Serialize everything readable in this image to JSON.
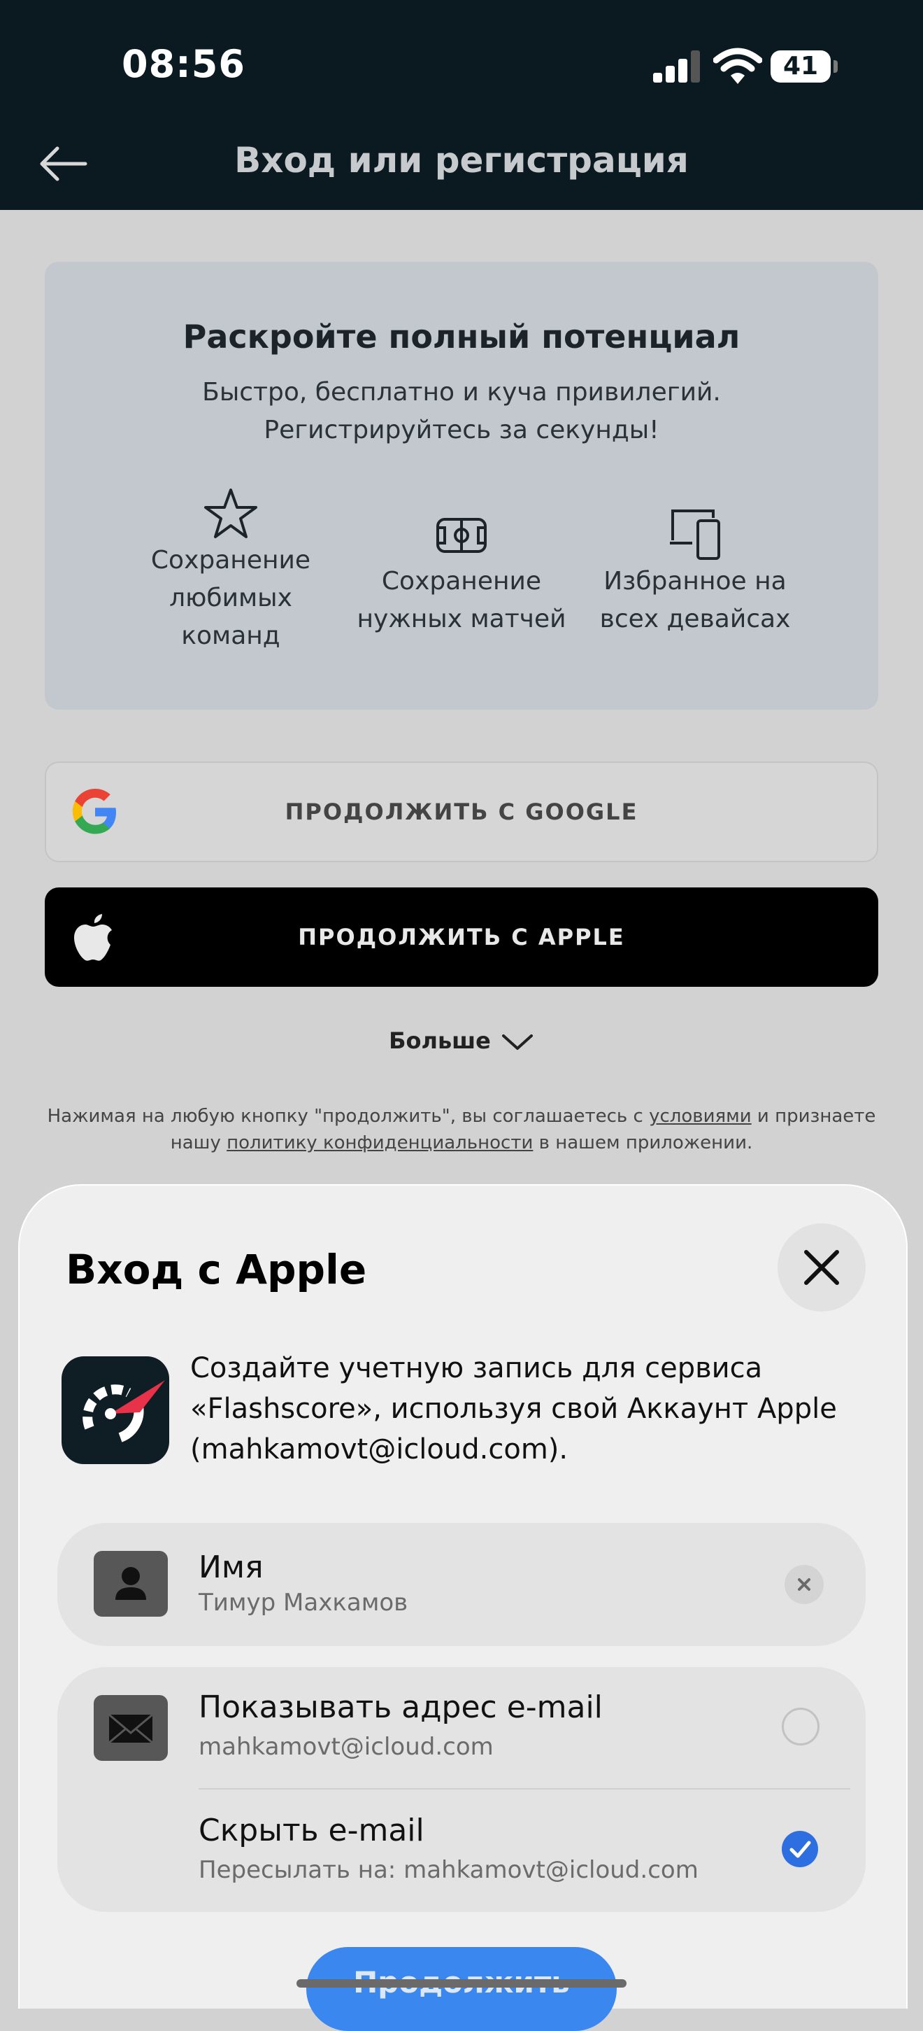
{
  "status_bar": {
    "time": "08:56",
    "battery": "41",
    "signal_icon": "cellular-signal-icon",
    "wifi_icon": "wifi-icon"
  },
  "header": {
    "title": "Вход или регистрация",
    "back_icon": "arrow-left-icon"
  },
  "promo": {
    "title": "Раскройте полный потенциал",
    "subtitle": "Быстро, бесплатно и куча привилегий. Регистрируйтесь за секунды!",
    "features": [
      {
        "icon": "star-icon",
        "line1": "Сохранение",
        "line2": "любимых",
        "line3": "команд"
      },
      {
        "icon": "football-pitch-icon",
        "line1": "Сохранение",
        "line2": "нужных матчей"
      },
      {
        "icon": "devices-icon",
        "line1": "Избранное на",
        "line2": "всех девайсах"
      }
    ]
  },
  "buttons": {
    "google": "ПРОДОЛЖИТЬ С GOOGLE",
    "apple": "ПРОДОЛЖИТЬ С APPLE",
    "more": "Больше"
  },
  "legal": {
    "part1": "Нажимая на любую кнопку \"продолжить\", вы соглашаетесь с ",
    "terms_link": "условиями",
    "part2": " и признаете нашу ",
    "privacy_link": "политику конфиденциальности",
    "part3": " в нашем приложении."
  },
  "sheet": {
    "title": "Вход с Apple",
    "description": "Создайте учетную запись для сервиса «Flashscore», используя свой Аккаунт Apple (mahkamovt@icloud.com).",
    "name_label": "Имя",
    "name_value": "Тимур Махкамов",
    "share_email_label": "Показывать адрес e-mail",
    "share_email_value": "mahkamovt@icloud.com",
    "hide_email_label": "Скрыть e-mail",
    "hide_email_value": "Пересылать на: mahkamovt@icloud.com",
    "selected_option": "hide",
    "continue": "Продолжить"
  },
  "colors": {
    "header_bg": "#0b1a20",
    "accent_blue": "#3a87f0",
    "flashscore_red": "#e8324a"
  }
}
